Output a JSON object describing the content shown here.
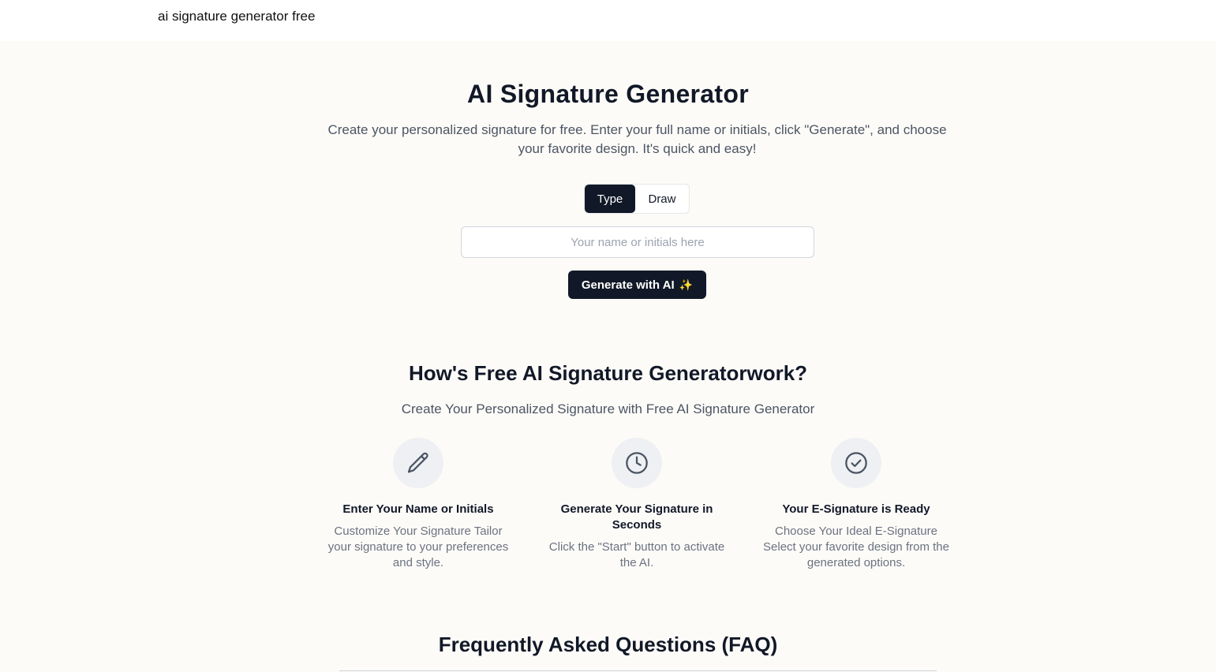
{
  "header": {
    "brand": "ai signature generator free"
  },
  "hero": {
    "title": "AI Signature Generator",
    "description": "Create your personalized signature for free. Enter your full name or initials, click \"Generate\", and choose your favorite design. It's quick and easy!",
    "mode_tabs": [
      {
        "label": "Type",
        "active": true
      },
      {
        "label": "Draw",
        "active": false
      }
    ],
    "name_input": {
      "placeholder": "Your name or initials here",
      "value": ""
    },
    "generate_button": {
      "label": "Generate with AI",
      "icon": "sparkles-icon",
      "icon_glyph": "✨"
    }
  },
  "how_it_works": {
    "title": "How's Free AI Signature Generatorwork?",
    "subtitle": "Create Your Personalized Signature with Free AI Signature Generator",
    "steps": [
      {
        "icon": "pencil-icon",
        "title": "Enter Your Name or Initials",
        "description": "Customize Your Signature Tailor your signature to your preferences and style."
      },
      {
        "icon": "clock-icon",
        "title": "Generate Your Signature in Seconds",
        "description": "Click the \"Start\" button to activate the AI."
      },
      {
        "icon": "check-circle-icon",
        "title": "Your E-Signature is Ready",
        "description": "Choose Your Ideal E-Signature Select your favorite design from the generated options."
      }
    ]
  },
  "faq": {
    "title": "Frequently Asked Questions (FAQ)"
  },
  "colors": {
    "primary": "#111827",
    "page_background": "#fdfbf8",
    "muted_text": "#6b7280",
    "icon_circle": "#eef0f3"
  }
}
